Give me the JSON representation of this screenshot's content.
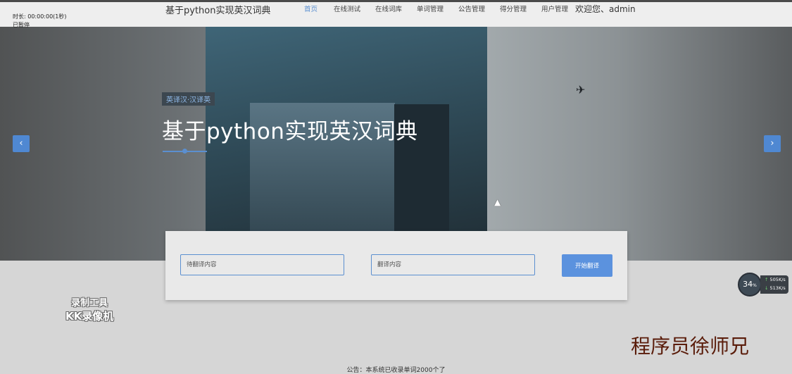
{
  "header": {
    "brand": "基于python实现英汉词典",
    "nav": [
      {
        "label": "首页",
        "active": true
      },
      {
        "label": "在线测试",
        "active": false
      },
      {
        "label": "在线词库",
        "active": false
      },
      {
        "label": "单词管理",
        "active": false
      },
      {
        "label": "公告管理",
        "active": false
      },
      {
        "label": "得分管理",
        "active": false
      },
      {
        "label": "用户管理",
        "active": false
      }
    ],
    "welcome": "欢迎您、admin"
  },
  "recorder_status": {
    "line1": "时长: 00:00:00(1秒)",
    "line2": "已暂停"
  },
  "hero": {
    "tag": "英译汉·汉译英",
    "title": "基于python实现英汉词典",
    "prev_arrow": "‹",
    "next_arrow": "›"
  },
  "translate": {
    "source_placeholder": "待翻译内容",
    "result_placeholder": "翻译内容",
    "button_label": "开始翻译"
  },
  "watermark": {
    "tool_line1": "录制工具",
    "tool_line2": "KK录像机",
    "author": "程序员徐师兄"
  },
  "speed_widget": {
    "percent": "34",
    "percent_unit": "%",
    "upload": "505",
    "upload_unit": "K/s",
    "download": "513",
    "download_unit": "K/s"
  },
  "notice": "公告：本系统已收录单词2000个了",
  "colors": {
    "accent": "#5b8fd0",
    "button": "#5b92de",
    "topbar": "#eeeeee"
  }
}
